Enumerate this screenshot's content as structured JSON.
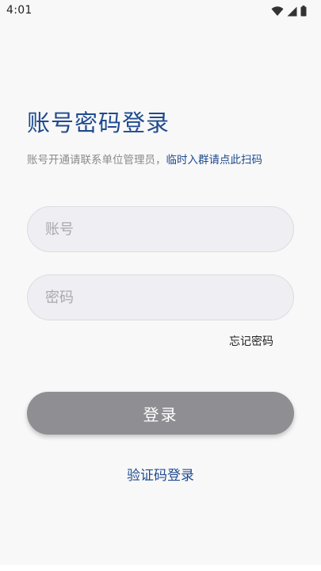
{
  "status_bar": {
    "time": "4:01",
    "icons": [
      "wifi-icon",
      "cellular-signal-icon",
      "battery-icon"
    ]
  },
  "login": {
    "title": "账号密码登录",
    "subtitle_plain": "账号开通请联系单位管理员，",
    "subtitle_link": "临时入群请点此扫码",
    "account_placeholder": "账号",
    "account_value": "",
    "password_placeholder": "密码",
    "password_value": "",
    "forgot_password": "忘记密码",
    "login_button": "登录",
    "sms_login": "验证码登录"
  },
  "colors": {
    "accent": "#1f4a8e",
    "button_disabled": "#8e8e93",
    "background": "#f8f8f8",
    "field_background": "#eeeef3"
  }
}
